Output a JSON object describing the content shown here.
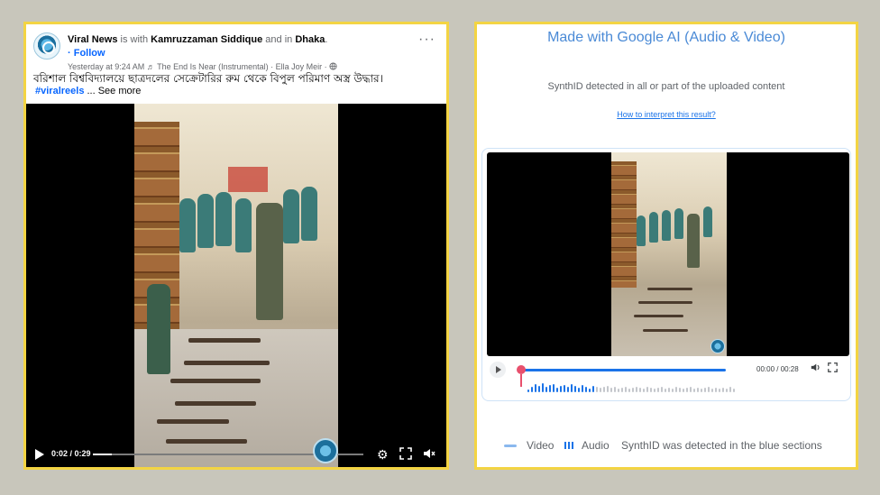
{
  "left_post": {
    "page_name": "Viral News",
    "with_text": "is with",
    "tagged_person": "Kamruzzaman Siddique",
    "and_in_text": "and in",
    "location": "Dhaka",
    "location_suffix": ".",
    "follow_label": "· Follow",
    "timestamp": "Yesterday at 9:24 AM",
    "song": "The End Is Near (Instrumental) · Ella Joy Meir",
    "visibility_separator": "·",
    "more_menu": "···",
    "caption": "বরিশাল বিশ্ববিদ্যালয়ে ছাত্রদলের সেক্রেটারির রুম থেকে বিপুল পরিমাণ অস্ত্র উদ্ধার।",
    "hashtag": "#viralreels",
    "see_more": "... See more",
    "video": {
      "time_current": "0:02",
      "time_total": "0:29",
      "time_separator": " / ",
      "progress_fraction": 0.069
    }
  },
  "synthid": {
    "title": "Made with Google AI (Audio & Video)",
    "subtitle": "SynthID detected in all or part of the uploaded content",
    "link": "How to interpret this result?",
    "player": {
      "time": "00:00 / 00:28",
      "progress_fraction": 0.0
    },
    "legend": {
      "video_label": "Video",
      "audio_label": "Audio",
      "note": "SynthID was detected in the blue sections"
    },
    "colors": {
      "detected": "#1a73e8",
      "undetected": "#c4c7cc",
      "playhead": "#e8506d"
    }
  },
  "icons": {
    "play": "play-icon",
    "settings": "gear-icon",
    "fullscreen": "expand-icon",
    "mute": "volume-muted-icon",
    "volume": "volume-icon",
    "music": "music-note-icon",
    "globe": "globe-icon"
  }
}
